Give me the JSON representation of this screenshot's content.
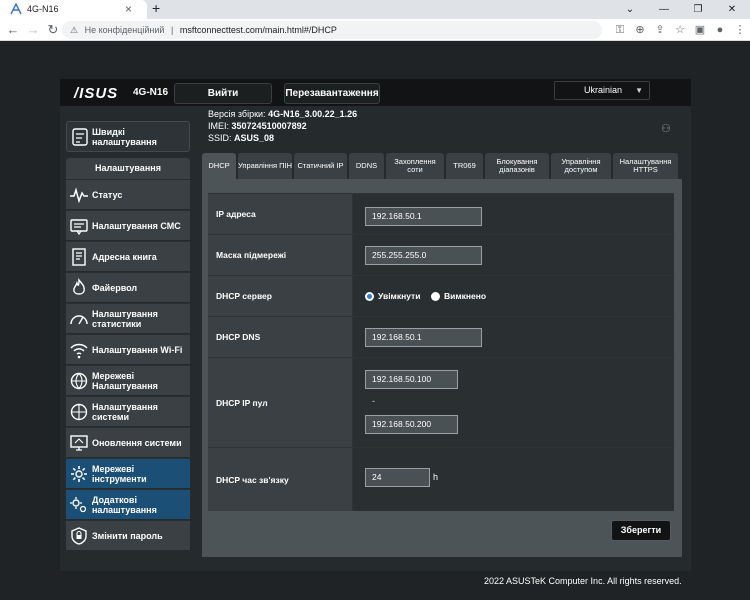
{
  "browser": {
    "tab_title": "4G-N16",
    "security_label": "Не конфіденційний",
    "url": "msftconnecttest.com/main.html#/DHCP"
  },
  "header": {
    "logo": "/ISUS",
    "model": "4G-N16",
    "logout_label": "Вийти",
    "reboot_label": "Перезавантаження",
    "language": "Ukrainian"
  },
  "info": {
    "build_label": "Версія збірки:",
    "build_value": "4G-N16_3.00.22_1.26",
    "imei_label": "IMEI:",
    "imei_value": "350724510007892",
    "ssid_label": "SSID:",
    "ssid_value": "ASUS_08"
  },
  "sidebar": {
    "quick_label": "Швидкі налаштування",
    "menu_title": "Налаштування",
    "items": [
      {
        "label": "Статус"
      },
      {
        "label": "Налаштування СМС"
      },
      {
        "label": "Адресна книга"
      },
      {
        "label": "Файервол"
      },
      {
        "label": "Налаштування статистики"
      },
      {
        "label": "Налаштування Wi-Fi"
      },
      {
        "label": "Мережеві Налаштування"
      },
      {
        "label": "Налаштування системи"
      },
      {
        "label": "Оновлення системи"
      },
      {
        "label": "Мережеві інструменти"
      },
      {
        "label": "Додаткові налаштування"
      },
      {
        "label": "Змінити пароль"
      }
    ]
  },
  "tabs": [
    {
      "label": "DHCP"
    },
    {
      "label": "Управління ПІН"
    },
    {
      "label": "Статичний IP"
    },
    {
      "label": "DDNS"
    },
    {
      "label": "Захоплення соти"
    },
    {
      "label": "TR069"
    },
    {
      "label": "Блокування діапазонів"
    },
    {
      "label": "Управління доступом"
    },
    {
      "label": "Налаштування HTTPS"
    }
  ],
  "form": {
    "ip_label": "IP адреса",
    "ip_value": "192.168.50.1",
    "mask_label": "Маска підмережі",
    "mask_value": "255.255.255.0",
    "dhcp_server_label": "DHCP сервер",
    "enabled_label": "Увімкнути",
    "disabled_label": "Вимкнено",
    "dns_label": "DHCP DNS",
    "dns_value": "192.168.50.1",
    "pool_label": "DHCP IP пул",
    "pool_start": "192.168.50.100",
    "pool_separator": "-",
    "pool_end": "192.168.50.200",
    "lease_label": "DHCP час зв'язку",
    "lease_value": "24",
    "lease_unit": "h",
    "save_label": "Зберегти"
  },
  "footer": {
    "copyright": "2022 ASUSTeK Computer Inc. All rights reserved."
  },
  "colors": {
    "active_menu": "#1c4f75",
    "radio_selected": "#2f7be0"
  }
}
